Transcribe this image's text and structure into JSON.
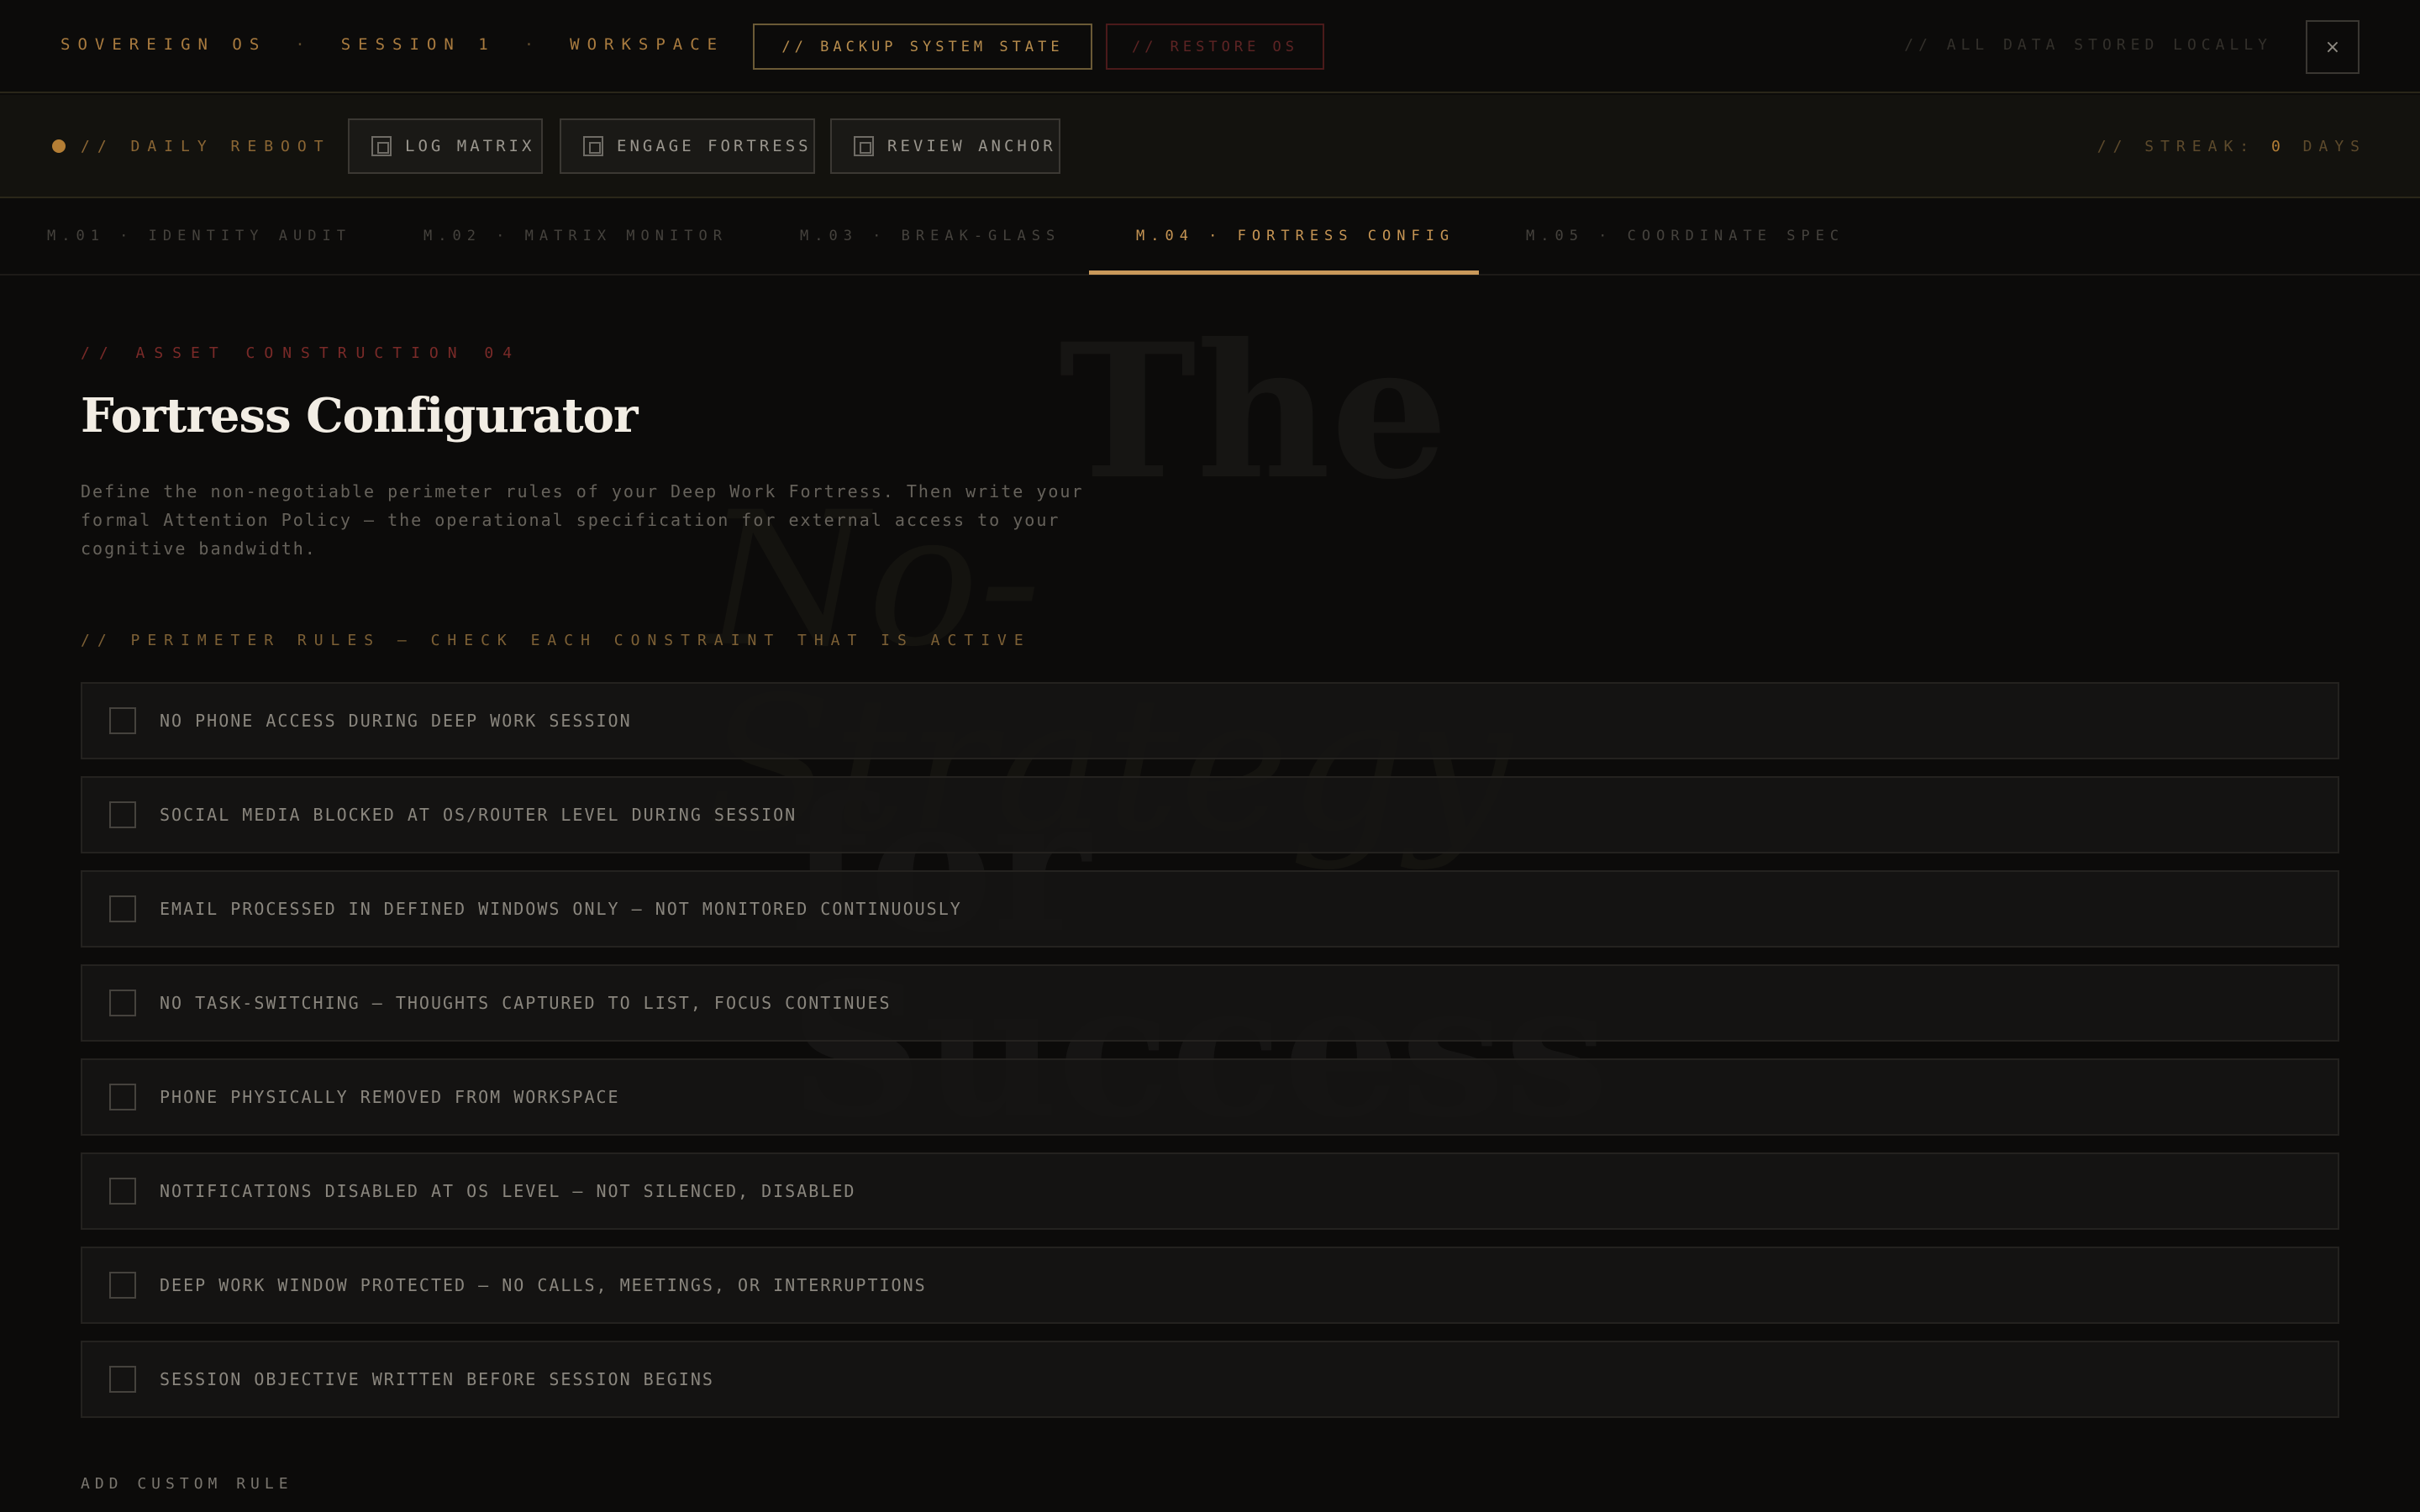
{
  "topbar": {
    "crumbs": [
      "SOVEREIGN OS",
      "SESSION 1",
      "WORKSPACE"
    ],
    "crumb_separator": "·",
    "backup_label": "// BACKUP SYSTEM STATE",
    "restore_label": "// RESTORE OS",
    "local_note": "// ALL DATA STORED LOCALLY",
    "close_label": "×"
  },
  "reboot": {
    "label": "// DAILY REBOOT",
    "rituals": [
      {
        "label": "LOG MATRIX",
        "icon": "square-icon"
      },
      {
        "label": "ENGAGE FORTRESS",
        "icon": "square-icon"
      },
      {
        "label": "REVIEW ANCHOR",
        "icon": "square-icon"
      }
    ],
    "streak_prefix": "// STREAK: ",
    "streak_value": "0",
    "streak_suffix": " DAYS"
  },
  "tabs": [
    {
      "label": "M.01 · IDENTITY AUDIT",
      "active": false
    },
    {
      "label": "M.02 · MATRIX MONITOR",
      "active": false
    },
    {
      "label": "M.03 · BREAK-GLASS",
      "active": false
    },
    {
      "label": "M.04 · FORTRESS CONFIG",
      "active": true
    },
    {
      "label": "M.05 · COORDINATE SPEC",
      "active": false
    }
  ],
  "main": {
    "eyebrow": "// ASSET CONSTRUCTION 04",
    "title": "Fortress Configurator",
    "description": "Define the non-negotiable perimeter rules of your Deep Work Fortress. Then write your formal Attention Policy — the operational specification for external access to your cognitive bandwidth.",
    "rules_heading": "// PERIMETER RULES — CHECK EACH CONSTRAINT THAT IS ACTIVE",
    "rules": [
      {
        "label": "NO PHONE ACCESS DURING DEEP WORK SESSION",
        "checked": false
      },
      {
        "label": "SOCIAL MEDIA BLOCKED AT OS/ROUTER LEVEL DURING SESSION",
        "checked": false
      },
      {
        "label": "EMAIL PROCESSED IN DEFINED WINDOWS ONLY — NOT MONITORED CONTINUOUSLY",
        "checked": false
      },
      {
        "label": "NO TASK-SWITCHING — THOUGHTS CAPTURED TO LIST, FOCUS CONTINUES",
        "checked": false
      },
      {
        "label": "PHONE PHYSICALLY REMOVED FROM WORKSPACE",
        "checked": false
      },
      {
        "label": "NOTIFICATIONS DISABLED AT OS LEVEL — NOT SILENCED, DISABLED",
        "checked": false
      },
      {
        "label": "DEEP WORK WINDOW PROTECTED — NO CALLS, MEETINGS, OR INTERRUPTIONS",
        "checked": false
      },
      {
        "label": "SESSION OBJECTIVE WRITTEN BEFORE SESSION BEGINS",
        "checked": false
      }
    ],
    "add_rule_label": "ADD CUSTOM RULE"
  },
  "watermark": {
    "line1": "The",
    "line2": "No-Strategy",
    "line3": "for Success"
  },
  "colors": {
    "accent": "#c69554",
    "danger": "#7a2a28",
    "background": "#0c0b0a"
  }
}
